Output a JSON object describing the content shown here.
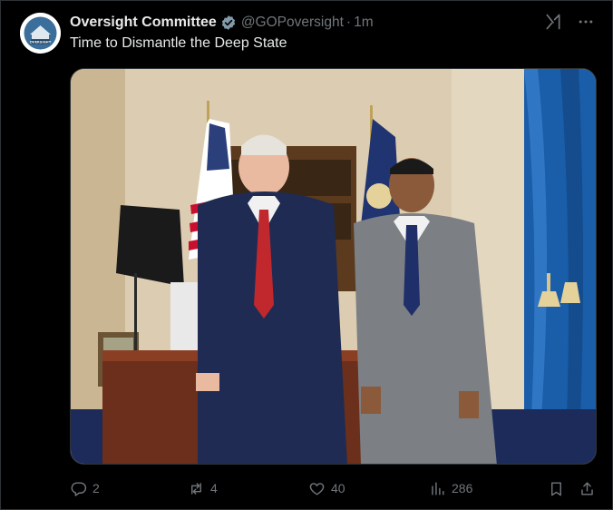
{
  "account": {
    "display_name": "Oversight Committee",
    "handle": "@GOPoversight",
    "separator": "·",
    "time": "1m",
    "verified_color": "#829aab",
    "avatar_text": "OVERSIGHT"
  },
  "tweet": {
    "text": "Time to Dismantle the Deep State"
  },
  "top_icons": {
    "grok": "grok-icon",
    "more": "more-icon"
  },
  "media": {
    "description_icon": "photo"
  },
  "actions": {
    "replies": "2",
    "reposts": "4",
    "likes": "40",
    "views": "286"
  },
  "colors": {
    "background": "#000000",
    "text": "#e7e9ea",
    "muted": "#71767b",
    "border": "#2f3336"
  }
}
